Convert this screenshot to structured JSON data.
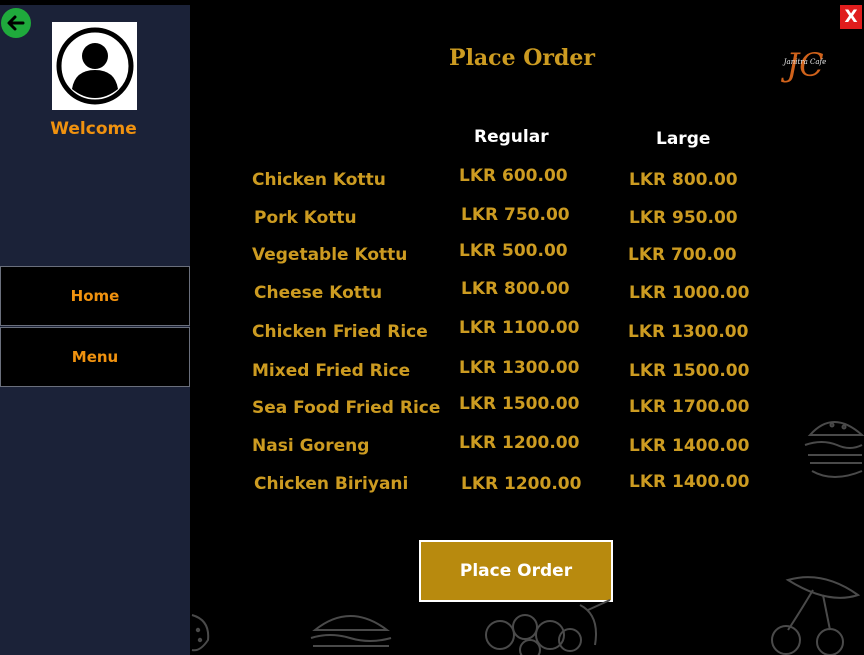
{
  "sidebar": {
    "welcome": "Welcome",
    "nav": {
      "home": "Home",
      "menu": "Menu"
    }
  },
  "window": {
    "close_label": "X"
  },
  "header": {
    "title": "Place Order",
    "logo_text": "Janitra Cafe",
    "logo_monogram": "JC"
  },
  "columns": {
    "regular": "Regular",
    "large": "Large"
  },
  "menu_items": [
    {
      "name": "Chicken Kottu",
      "regular": "LKR 600.00",
      "large": "LKR 800.00"
    },
    {
      "name": "Pork Kottu",
      "regular": "LKR 750.00",
      "large": "LKR 950.00"
    },
    {
      "name": "Vegetable Kottu",
      "regular": "LKR 500.00",
      "large": "LKR 700.00"
    },
    {
      "name": "Cheese Kottu",
      "regular": "LKR 800.00",
      "large": "LKR 1000.00"
    },
    {
      "name": "Chicken Fried Rice",
      "regular": "LKR 1100.00",
      "large": "LKR 1300.00"
    },
    {
      "name": "Mixed Fried Rice",
      "regular": "LKR 1300.00",
      "large": "LKR 1500.00"
    },
    {
      "name": "Sea Food Fried Rice",
      "regular": "LKR 1500.00",
      "large": "LKR 1700.00"
    },
    {
      "name": "Nasi Goreng",
      "regular": "LKR 1200.00",
      "large": "LKR 1400.00"
    },
    {
      "name": "Chicken Biriyani",
      "regular": "LKR 1200.00",
      "large": "LKR 1400.00"
    }
  ],
  "actions": {
    "place_order": "Place Order"
  },
  "icons": {
    "back": "back-arrow-icon",
    "avatar": "user-avatar-icon",
    "close": "close-icon",
    "decor": [
      "burger-doodle-icon",
      "fruit-doodle-icon",
      "cherry-doodle-icon",
      "strawberry-doodle-icon"
    ]
  },
  "colors": {
    "sidebar": "#1b2238",
    "accent": "#cc9b21",
    "welcome": "#f0920f",
    "button": "#b88a0e",
    "close": "#e01d1d",
    "back": "#1faa3c"
  }
}
